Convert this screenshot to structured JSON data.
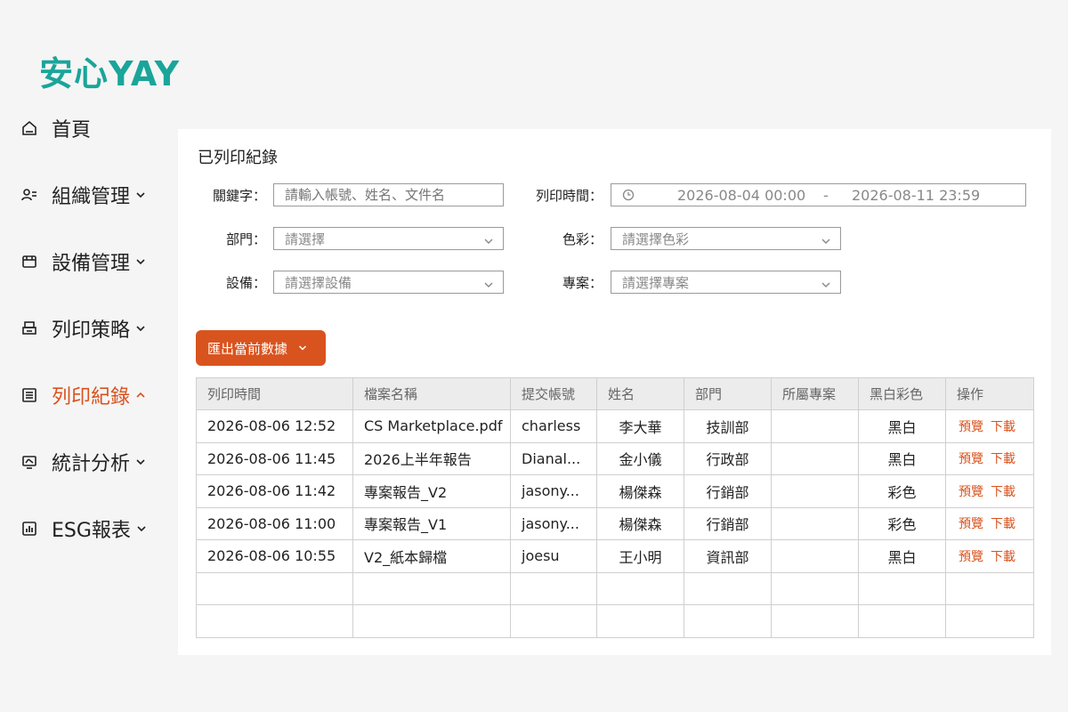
{
  "brand": "安心YAY",
  "nav": [
    {
      "label": "首頁",
      "icon": "home-icon"
    },
    {
      "label": "組織管理",
      "icon": "users-icon"
    },
    {
      "label": "設備管理",
      "icon": "device-icon"
    },
    {
      "label": "列印策略",
      "icon": "printer-icon"
    },
    {
      "label": "列印紀錄",
      "icon": "list-icon"
    },
    {
      "label": "統計分析",
      "icon": "stats-icon"
    },
    {
      "label": "ESG報表",
      "icon": "chart-icon"
    }
  ],
  "panel": {
    "title": "已列印紀錄",
    "filters": {
      "keyword_label": "關鍵字：",
      "keyword_placeholder": "請輸入帳號、姓名、文件名",
      "time_label": "列印時間：",
      "time_start": "2026-08-04 00:00",
      "time_sep": "-",
      "time_end": "2026-08-11 23:59",
      "dept_label": "部門：",
      "dept_placeholder": "請選擇",
      "color_label": "色彩：",
      "color_placeholder": "請選擇色彩",
      "device_label": "設備：",
      "device_placeholder": "請選擇設備",
      "project_label": "專案：",
      "project_placeholder": "請選擇專案"
    },
    "export_label": "匯出當前數據",
    "columns": [
      "列印時間",
      "檔案名稱",
      "提交帳號",
      "姓名",
      "部門",
      "所屬專案",
      "黑白彩色",
      "操作"
    ],
    "rows": [
      {
        "time": "2026-08-06 12:52",
        "file": "CS Marketplace.pdf",
        "account": "charless",
        "name": "李大華",
        "dept": "技訓部",
        "project": "",
        "color": "黑白"
      },
      {
        "time": "2026-08-06 11:45",
        "file": "2026上半年報告",
        "account": "Dianal...",
        "name": "金小儀",
        "dept": "行政部",
        "project": "",
        "color": "黑白"
      },
      {
        "time": "2026-08-06 11:42",
        "file": "專案報告_V2",
        "account": "jasony...",
        "name": "楊傑森",
        "dept": "行銷部",
        "project": "",
        "color": "彩色"
      },
      {
        "time": "2026-08-06 11:00",
        "file": "專案報告_V1",
        "account": "jasony...",
        "name": "楊傑森",
        "dept": "行銷部",
        "project": "",
        "color": "彩色"
      },
      {
        "time": "2026-08-06 10:55",
        "file": "V2_紙本歸檔",
        "account": "joesu",
        "name": "王小明",
        "dept": "資訊部",
        "project": "",
        "color": "黑白"
      }
    ],
    "op_preview": "預覽",
    "op_download": "下載"
  },
  "colors": {
    "accent": "#d9531e",
    "brand": "#1aa59a"
  }
}
